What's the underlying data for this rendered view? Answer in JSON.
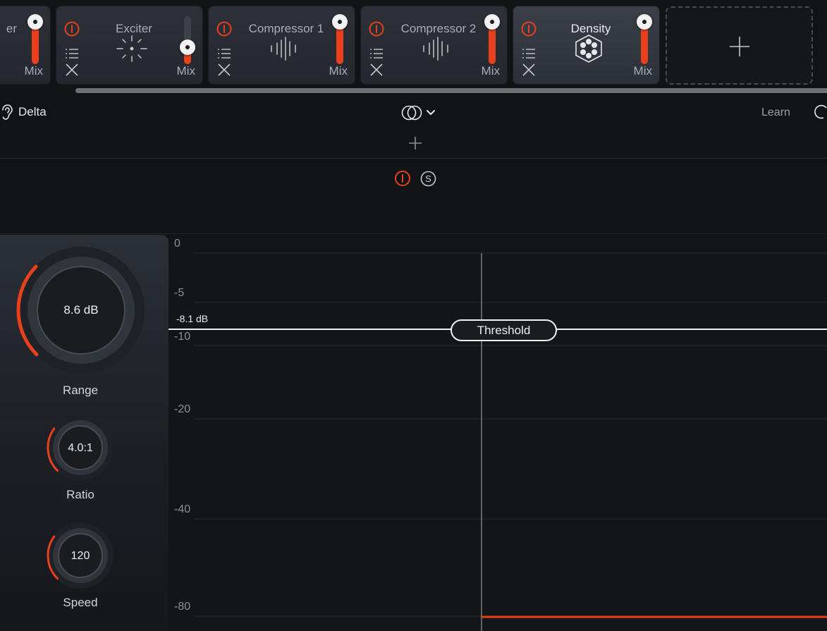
{
  "chain": {
    "modules": [
      {
        "title": "er",
        "mix_label": "Mix",
        "mix_level": 0.95
      },
      {
        "title": "Exciter",
        "mix_label": "Mix",
        "mix_level": 0.35
      },
      {
        "title": "Compressor 1",
        "mix_label": "Mix",
        "mix_level": 0.95
      },
      {
        "title": "Compressor 2",
        "mix_label": "Mix",
        "mix_level": 0.95
      },
      {
        "title": "Density",
        "mix_label": "Mix",
        "mix_level": 0.95,
        "selected": true
      }
    ],
    "add_module_icon": "plus-icon"
  },
  "toolbar": {
    "delta_label": "Delta",
    "learn_label": "Learn",
    "stereo_icon": "stereo-link-icon",
    "add_band_icon": "plus-icon"
  },
  "band": {
    "power_icon": "power-icon",
    "solo_label": "S"
  },
  "controls": {
    "range": {
      "value": "8.6 dB",
      "label": "Range",
      "arc_fraction": 0.33
    },
    "ratio": {
      "value": "4.0:1",
      "label": "Ratio",
      "arc_fraction": 0.3
    },
    "speed": {
      "value": "120",
      "label": "Speed",
      "arc_fraction": 0.3
    }
  },
  "graph": {
    "y_ticks": [
      "0",
      "-5",
      "-10",
      "-20",
      "-40",
      "-80"
    ],
    "threshold_value": "-8.1 dB",
    "threshold_label": "Threshold",
    "colors": {
      "accent": "#e8401c",
      "threshold": "#f0f0f0"
    }
  }
}
